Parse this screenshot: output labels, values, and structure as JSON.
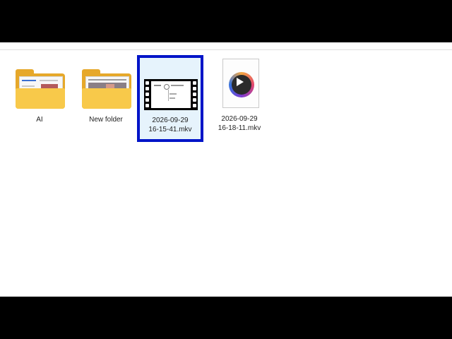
{
  "files": [
    {
      "name": "AI",
      "type": "folder"
    },
    {
      "name": "New folder",
      "type": "folder"
    },
    {
      "name_line1": "2026-09-29",
      "name_line2": "16-15-41.mkv",
      "type": "video-thumbnail",
      "selected": true
    },
    {
      "name_line1": "2026-09-29",
      "name_line2": "16-18-11.mkv",
      "type": "media-file"
    }
  ],
  "colors": {
    "selection_border": "#0014c8",
    "selection_fill": "#e6f3fc",
    "folder_front": "#f8c94a",
    "folder_back": "#e6a82a"
  },
  "icons": [
    "folder-icon",
    "folder-icon",
    "video-thumbnail-icon",
    "media-player-icon"
  ]
}
